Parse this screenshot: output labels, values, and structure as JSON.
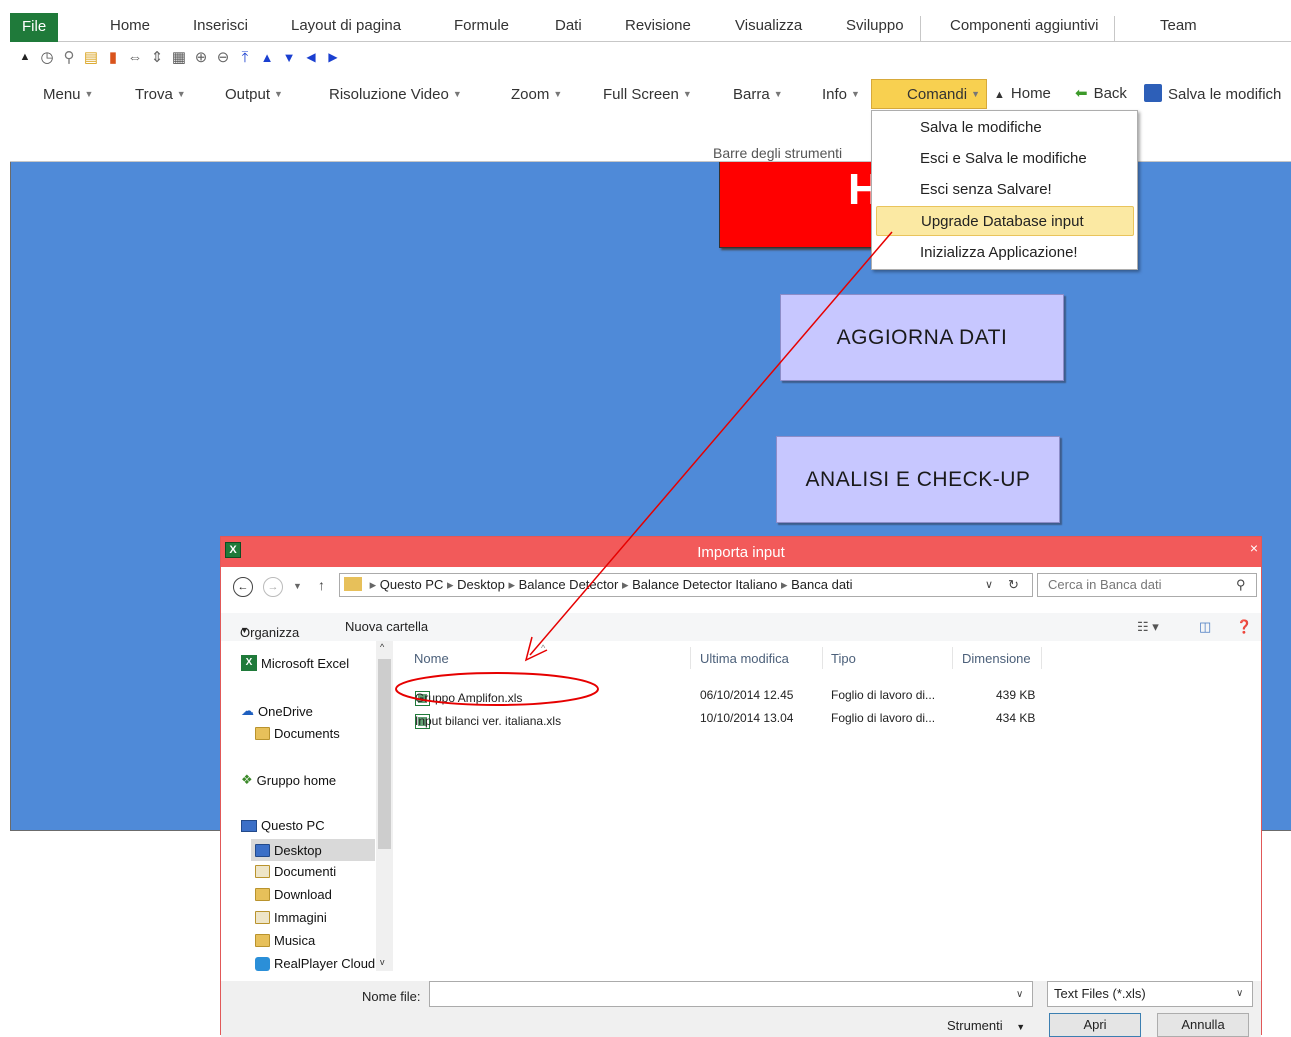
{
  "ribbon": {
    "tabs": [
      "File",
      "Home",
      "Inserisci",
      "Layout di pagina",
      "Formule",
      "Dati",
      "Revisione",
      "Visualizza",
      "Sviluppo",
      "Componenti aggiuntivi",
      "Team"
    ]
  },
  "toolbar": {
    "menu": "Menu",
    "trova": "Trova",
    "output": "Output",
    "risoluzione": "Risoluzione Video",
    "zoom": "Zoom",
    "fullscreen": "Full Screen",
    "barra": "Barra",
    "info": "Info",
    "comandi": "Comandi",
    "home": "Home",
    "back": "Back",
    "salva": "Salva le modifich",
    "group_label": "Barre degli strumenti"
  },
  "dropdown": {
    "items": [
      "Salva le modifiche",
      "Esci e Salva le modifiche",
      "Esci senza Salvare!",
      "Upgrade Database input",
      "Inizializza Applicazione!"
    ],
    "highlighted": "Upgrade Database input"
  },
  "sheet": {
    "red_text": "H",
    "btn_aggiorna": "AGGIORNA DATI",
    "btn_analisi": "ANALISI E CHECK-UP"
  },
  "dialog": {
    "title": "Importa input",
    "path": [
      "Questo PC",
      "Desktop",
      "Balance Detector",
      "Balance Detector Italiano",
      "Banca dati"
    ],
    "search_placeholder": "Cerca in Banca dati",
    "organizza": "Organizza",
    "nuova_cartella": "Nuova cartella",
    "nav": {
      "excel": "Microsoft Excel",
      "onedrive": "OneDrive",
      "documents": "Documents",
      "gruppo_home": "Gruppo home",
      "questo_pc": "Questo PC",
      "desktop": "Desktop",
      "documenti": "Documenti",
      "download": "Download",
      "immagini": "Immagini",
      "musica": "Musica",
      "realplayer": "RealPlayer Cloud"
    },
    "columns": {
      "nome": "Nome",
      "ultima": "Ultima modifica",
      "tipo": "Tipo",
      "dimensione": "Dimensione"
    },
    "files": [
      {
        "name": "Gruppo Amplifon.xls",
        "date": "06/10/2014 12.45",
        "type": "Foglio di lavoro di...",
        "size": "439 KB"
      },
      {
        "name": "Input bilanci ver. italiana.xls",
        "date": "10/10/2014 13.04",
        "type": "Foglio di lavoro di...",
        "size": "434 KB"
      }
    ],
    "filename_label": "Nome file:",
    "filter": "Text Files (*.xls)",
    "strumenti": "Strumenti",
    "apri": "Apri",
    "annulla": "Annulla"
  },
  "colors": {
    "sheet_blue": "#4f8ad8",
    "excel_green": "#1f7a3a",
    "dialog_red": "#f25a5a",
    "highlight": "#fbe9a3",
    "annotation_red": "#e60000"
  }
}
